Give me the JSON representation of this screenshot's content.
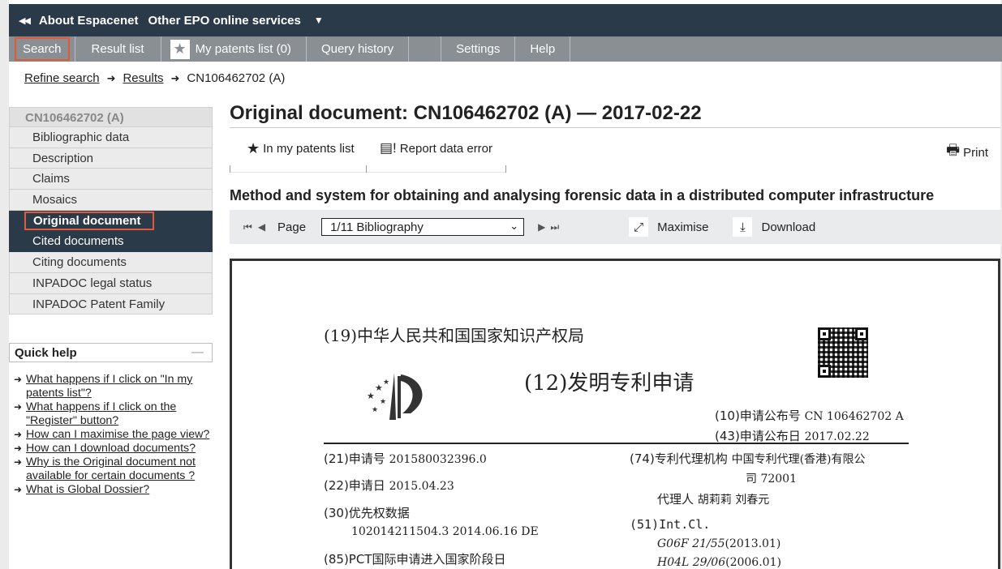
{
  "topbar": {
    "about": "About Espacenet",
    "other": "Other EPO online services"
  },
  "nav": {
    "search": "Search",
    "result_list": "Result list",
    "my_patents": "My patents list (0)",
    "query_history": "Query history",
    "settings": "Settings",
    "help": "Help"
  },
  "breadcrumb": {
    "refine": "Refine search",
    "results": "Results",
    "current": "CN106462702 (A)"
  },
  "sidebar": {
    "header": "CN106462702 (A)",
    "items": [
      "Bibliographic data",
      "Description",
      "Claims",
      "Mosaics",
      "Original document",
      "Cited documents",
      "Citing documents",
      "INPADOC legal status",
      "INPADOC Patent Family"
    ]
  },
  "quick_help": {
    "title": "Quick help",
    "links": [
      "What happens if I click on \"In my patents list\"?",
      "What happens if I click on the \"Register\" button?",
      "How can I maximise the page view?",
      "How can I download documents?",
      "Why is the Original document not available for certain documents ?",
      "What is Global Dossier?"
    ]
  },
  "main": {
    "title": "Original document: CN106462702 (A) — 2017-02-22",
    "in_list": "In my patents list",
    "report": "Report data error",
    "print": "Print",
    "doc_title": "Method and system for obtaining and analysing forensic data in a distributed computer infrastructure"
  },
  "viewer": {
    "page_label": "Page",
    "page_select": "1/11 Bibliography",
    "maximise": "Maximise",
    "download": "Download"
  },
  "document": {
    "office": "(19)中华人民共和国国家知识产权局",
    "doc_type": "(12)发明专利申请",
    "pub_no_label": "(10)申请公布号",
    "pub_no": "CN 106462702 A",
    "pub_date_label": "(43)申请公布日",
    "pub_date": "2017.02.22",
    "app_no_label": "(21)申请号",
    "app_no": "201580032396.0",
    "app_date_label": "(22)申请日",
    "app_date": "2015.04.23",
    "priority_label": "(30)优先权数据",
    "priority": "102014211504.3  2014.06.16  DE",
    "pct_label": "(85)PCT国际申请进入国家阶段日",
    "agency_label": "(74)专利代理机构",
    "agency": "中国专利代理(香港)有限公",
    "agency2": "司  72001",
    "agent_label": "代理人",
    "agent": "胡莉莉   刘春元",
    "intcl_label": "(51)Int.Cl.",
    "cl1": "G06F 21/55",
    "cl1d": "(2013.01)",
    "cl2": "H04L 29/06",
    "cl2d": "(2006.01)"
  },
  "colors": {
    "dark": "#2b3a49",
    "nav": "#8a8f94",
    "highlight": "#e05a3a"
  }
}
